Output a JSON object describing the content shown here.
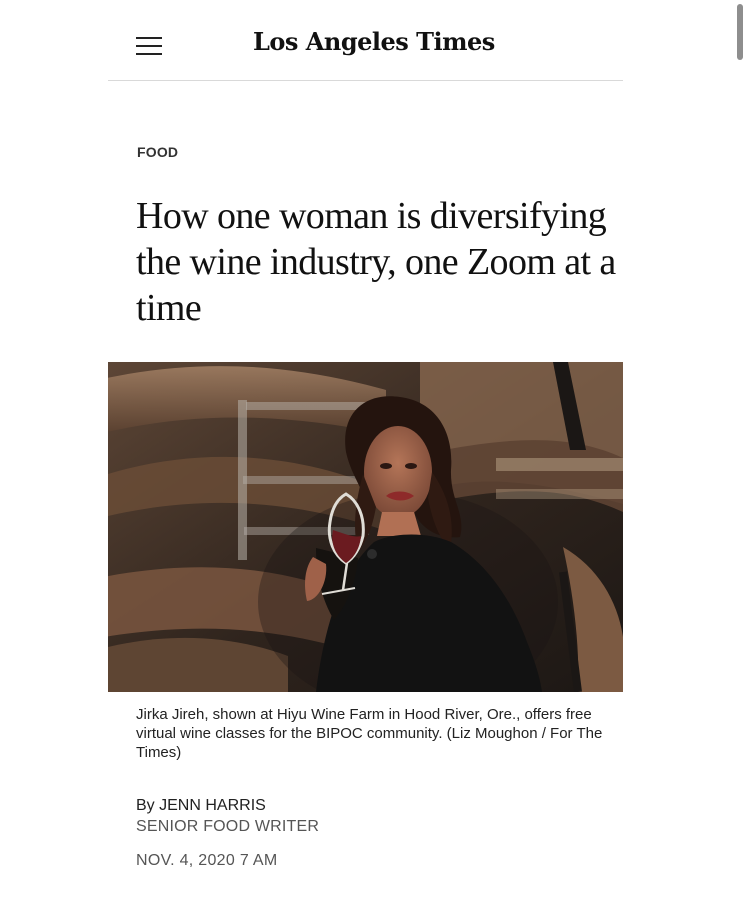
{
  "header": {
    "logo_text": "Los Angeles Times",
    "menu_icon": "hamburger-menu-icon"
  },
  "article": {
    "section": "FOOD",
    "headline": "How one woman is diversifying the wine industry, one Zoom at a time",
    "caption": "Jirka Jireh, shown at Hiyu Wine Farm in Hood River, Ore., offers free virtual wine classes for the BIPOC community.  (Liz Moughon / For The Times)",
    "byline_prefix": "By ",
    "author": "JENN HARRIS",
    "author_role": "SENIOR FOOD WRITER",
    "date": "NOV. 4, 2020 7 AM"
  },
  "colors": {
    "text": "#111111",
    "muted": "#555555",
    "divider": "#d9d9d9",
    "background": "#ffffff"
  }
}
